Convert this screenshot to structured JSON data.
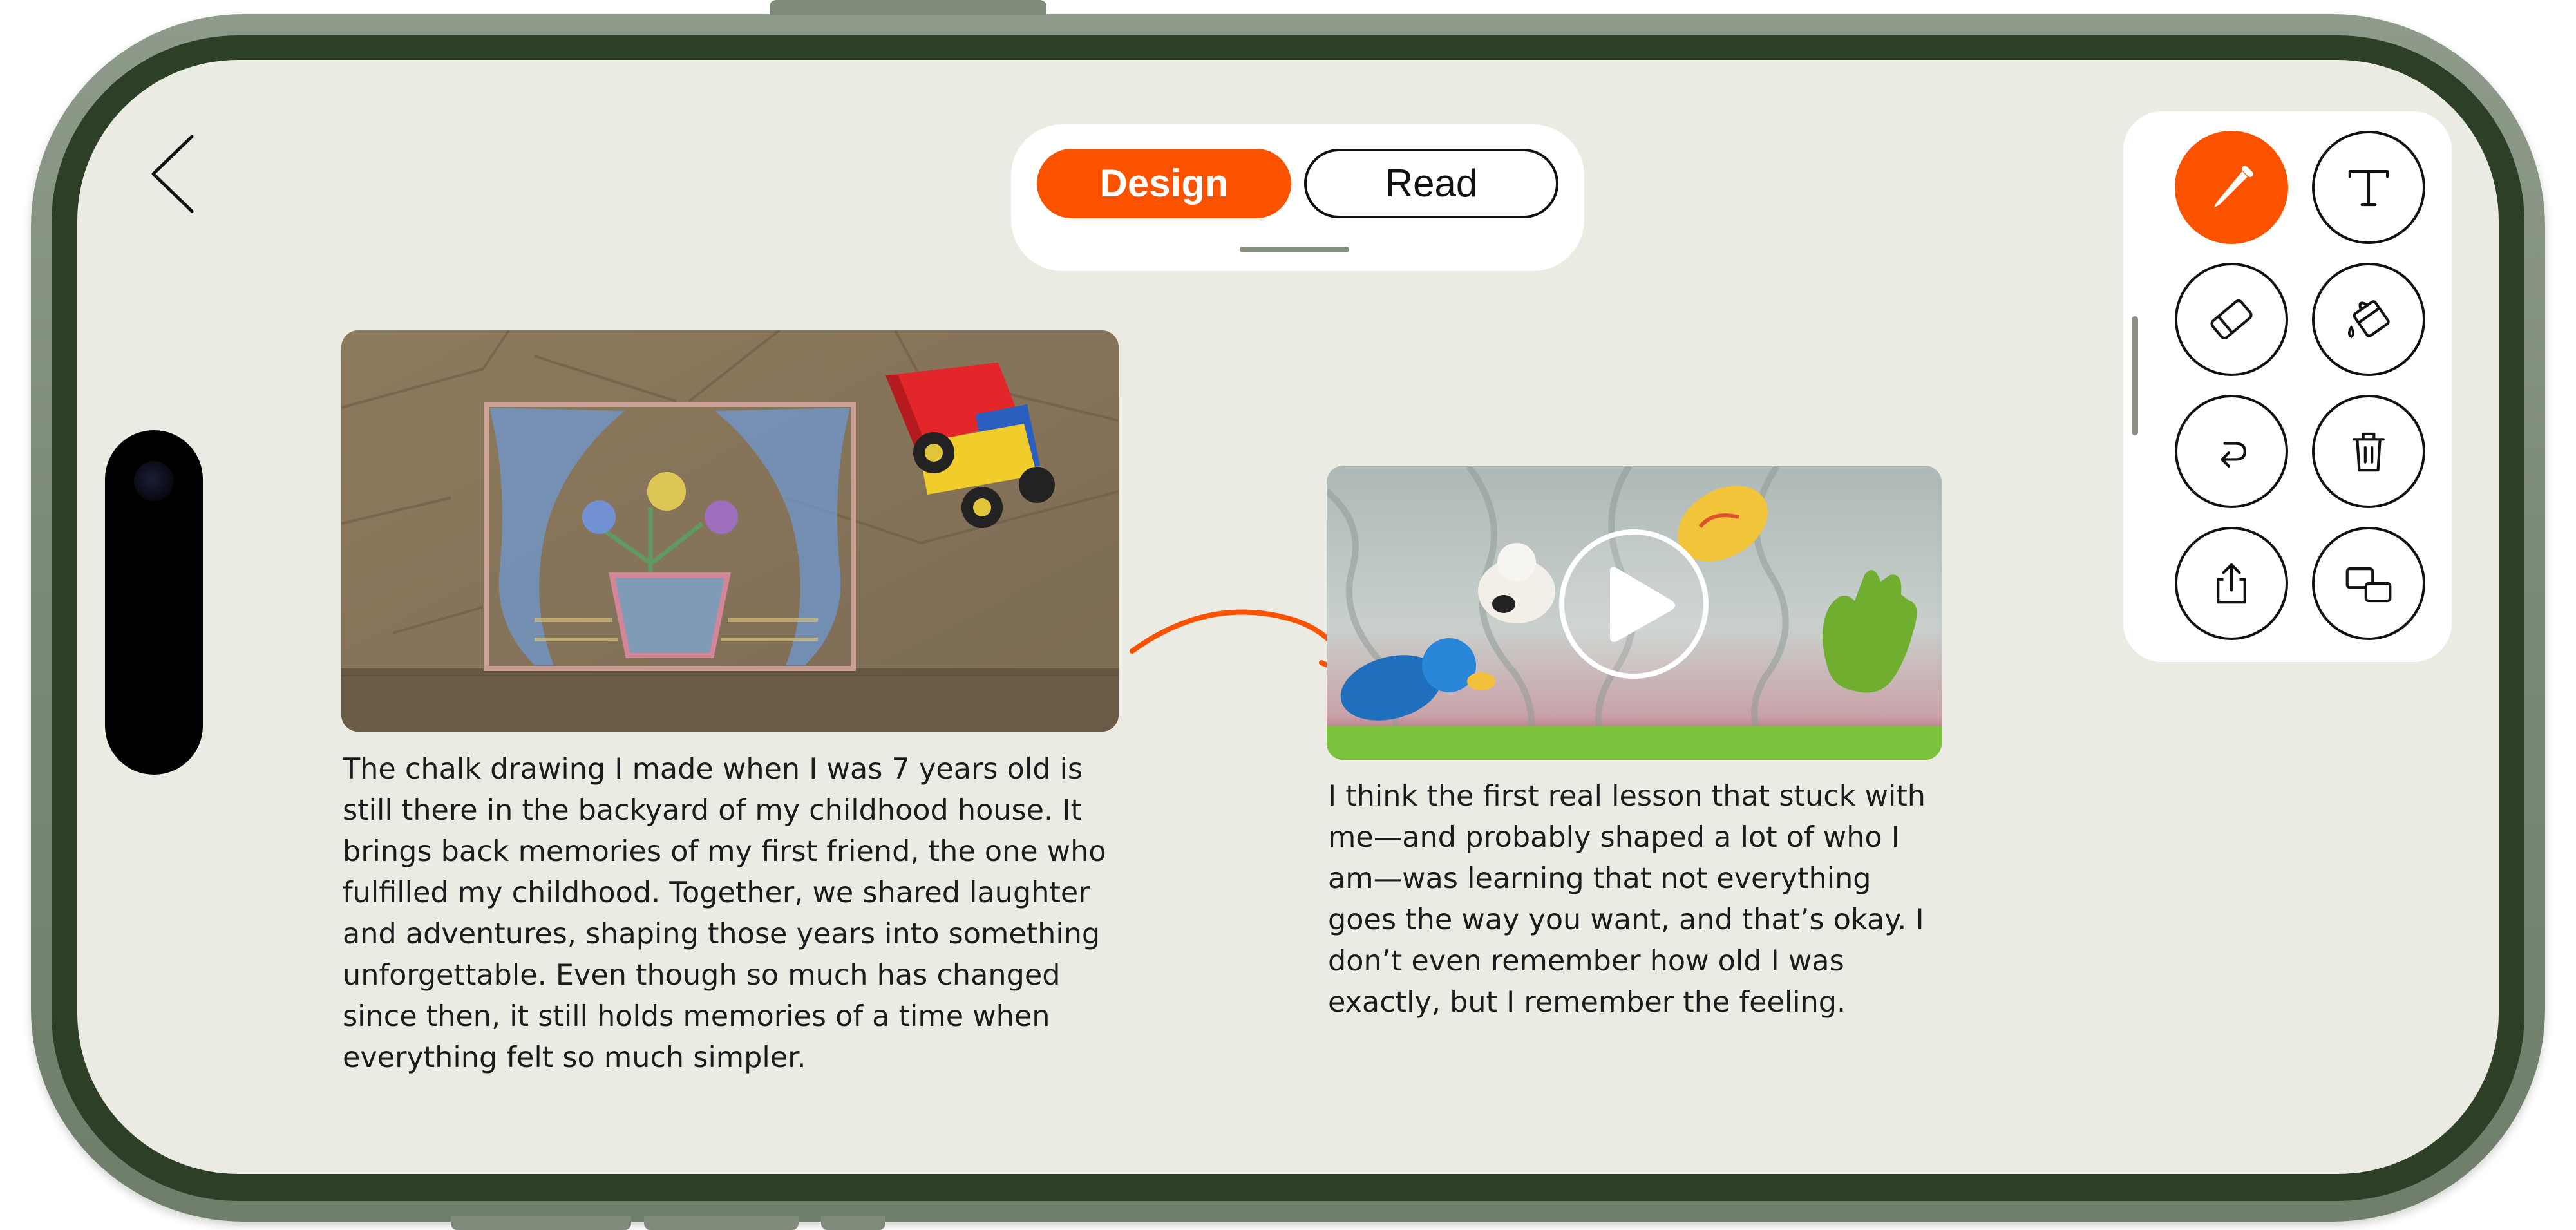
{
  "segment": {
    "design_label": "Design",
    "read_label": "Read",
    "selected": "Design"
  },
  "colors": {
    "accent": "#fb5200",
    "screen_bg": "#ebebe3",
    "frame": "#2e3f27"
  },
  "toolbar": {
    "tools": [
      {
        "icon": "pencil-icon",
        "active": true
      },
      {
        "icon": "text-icon",
        "active": false
      },
      {
        "icon": "eraser-icon",
        "active": false
      },
      {
        "icon": "paint-bucket-icon",
        "active": false
      },
      {
        "icon": "undo-icon",
        "active": false
      },
      {
        "icon": "trash-icon",
        "active": false
      },
      {
        "icon": "share-icon",
        "active": false
      },
      {
        "icon": "arrange-icon",
        "active": false
      }
    ]
  },
  "cards": [
    {
      "media": "chalk-drawing-photo",
      "caption": "The chalk drawing I made when I was 7 years old is\nstill there in the backyard of my childhood house. It\nbrings back memories of my first friend, the one who\nfulfilled my childhood. Together, we shared laughter\nand adventures, shaping those years into something\nunforgettable. Even though so much has changed\nsince then, it still holds memories of a time when\neverything felt so much simpler."
    },
    {
      "media": "bath-toys-video",
      "caption": "I think the first real lesson that stuck with\nme—and probably shaped a lot of who I\nam—was learning that not everything\ngoes the way you want, and that’s okay. I\ndon’t even remember how old I was\nexactly, but I remember the feeling."
    }
  ]
}
